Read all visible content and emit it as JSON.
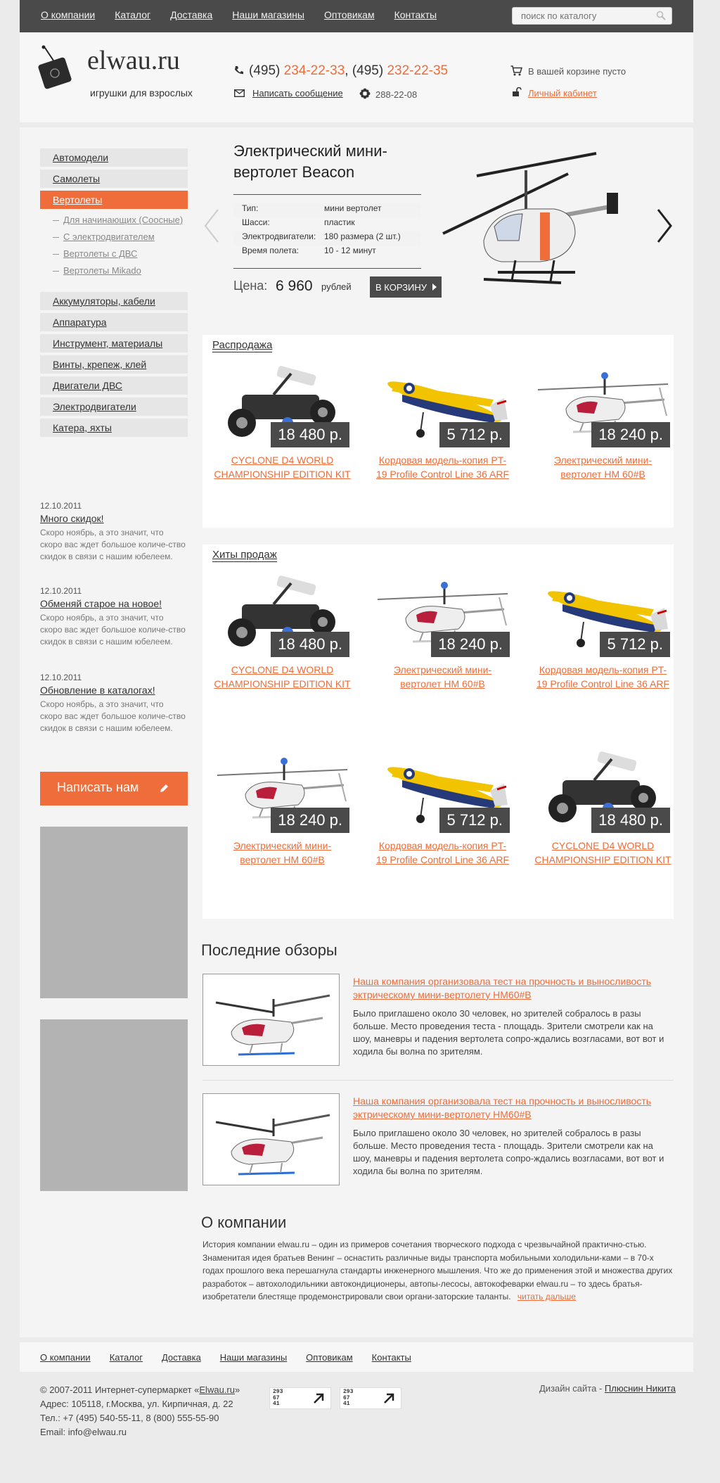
{
  "nav": [
    "О компании",
    "Каталог",
    "Доставка",
    "Наши магазины",
    "Оптовикам",
    "Контакты"
  ],
  "search": {
    "placeholder": "поиск по каталогу",
    "icon": "search-icon"
  },
  "logo": {
    "name": "elwau.ru",
    "tagline": "игрушки для взрослых"
  },
  "contacts": {
    "phone1_code": "(495)",
    "phone1": "234-22-33",
    "sep": ",",
    "phone2_code": "(495)",
    "phone2": "232-22-35",
    "write": "Написать сообщение",
    "icq": "288-22-08"
  },
  "cart": {
    "text": "В вашей корзине пусто",
    "cabinet": "Личный кабинет"
  },
  "sidebar": {
    "top": [
      "Автомодели",
      "Самолеты",
      "Вертолеты"
    ],
    "sub": [
      "Для начинающих (Соосные)",
      "С электродвигателем",
      "Вертолеты с ДВС",
      "Вертолеты Mikado"
    ],
    "rest": [
      "Аккумуляторы, кабели",
      "Аппаратура",
      "Инструмент, материалы",
      "Винты, крепеж, клей",
      "Двигатели ДВС",
      "Электродвигатели",
      "Катера, яхты"
    ]
  },
  "news": [
    {
      "date": "12.10.2011",
      "title": "Много скидок!",
      "text": "Скоро ноябрь, а это значит, что скоро вас ждет большое количе-ство скидок в связи с нашим юбелеем."
    },
    {
      "date": "12.10.2011",
      "title": "Обменяй старое на новое!",
      "text": "Скоро ноябрь, а это значит, что скоро вас ждет большое количе-ство скидок в связи с нашим юбелеем."
    },
    {
      "date": "12.10.2011",
      "title": "Обновление в каталогах!",
      "text": "Скоро ноябрь, а это значит, что скоро вас ждет большое количе-ство скидок в связи с нашим юбелеем."
    }
  ],
  "write_us": "Написать нам",
  "hero": {
    "title": "Электрический мини-вертолет Beacon",
    "specs": [
      [
        "Тип:",
        "мини вертолет"
      ],
      [
        "Шасси:",
        "пластик"
      ],
      [
        "Электродвигатели:",
        "180 размера (2 шт.)"
      ],
      [
        "Время полета:",
        "10 - 12 минут"
      ]
    ],
    "price_label": "Цена:",
    "price": "6 960",
    "currency": "рублей",
    "buy": "В КОРЗИНУ"
  },
  "sale": {
    "title": "Распродажа",
    "items": [
      {
        "name": "CYCLONE D4 WORLD CHAMPIONSHIP EDITION KIT",
        "price": "18 480 р.",
        "kind": "buggy"
      },
      {
        "name": "Кордовая модель-копия PT-19 Profile Control Line 36 ARF",
        "price": "5 712 р.",
        "kind": "plane"
      },
      {
        "name": "Электрический мини-вертолет HM 60#B",
        "price": "18 240 р.",
        "kind": "heli"
      }
    ]
  },
  "hits": {
    "title": "Хиты продаж",
    "items": [
      {
        "name": "CYCLONE D4 WORLD CHAMPIONSHIP EDITION KIT",
        "price": "18 480 р.",
        "kind": "buggy"
      },
      {
        "name": "Электрический мини-вертолет HM 60#B",
        "price": "18 240 р.",
        "kind": "heli"
      },
      {
        "name": "Кордовая модель-копия PT-19 Profile Control Line 36 ARF",
        "price": "5 712 р.",
        "kind": "plane"
      },
      {
        "name": "Электрический мини-вертолет HM 60#B",
        "price": "18 240 р.",
        "kind": "heli"
      },
      {
        "name": "Кордовая модель-копия PT-19 Profile Control Line 36 ARF",
        "price": "5 712 р.",
        "kind": "plane"
      },
      {
        "name": "CYCLONE D4 WORLD CHAMPIONSHIP EDITION KIT",
        "price": "18 480 р.",
        "kind": "buggy"
      }
    ]
  },
  "reviews": {
    "title": "Последние обзоры",
    "items": [
      {
        "title": "Наша компания организовала тест на прочность и выносливость эктрическому мини-вертолету HM60#B",
        "text": "Было приглашено около 30 человек, но зрителей собралось в разы больше. Место проведения теста - площадь. Зрители смотрели как на шоу, маневры и падения вертолета сопро-ждались возгласами, вот вот и ходила бы волна по зрителям."
      },
      {
        "title": "Наша компания организовала тест на прочность и выносливость эктрическому мини-вертолету HM60#B",
        "text": "Было приглашено около 30 человек, но зрителей собралось в разы больше. Место проведения теста - площадь. Зрители смотрели как на шоу, маневры и падения вертолета сопро-ждались возгласами, вот вот и ходила бы волна по зрителям."
      }
    ]
  },
  "about": {
    "title": "О компании",
    "text": "История компании elwau.ru – один из примеров сочетания творческого подхода с чрезвычайной практично-стью. Знаменитая идея братьев Венинг – оснастить различные виды транспорта мобильными холодильни-ками – в 70-х годах прошлого века перешагнула стандарты инженерного мышления. Что же до применения этой и множества других разработок – автохолодильники автокондиционеры, автопы-лесосы, автокофеварки elwau.ru – то здесь братья-изобретатели блестяще продемонстрировали свои органи-заторские таланты.",
    "more": "читать дальше"
  },
  "footer": {
    "copyright_pre": "© 2007-2011 Интернет-супермаркет «",
    "copyright_link": "Elwau.ru",
    "copyright_post": "»",
    "address": "Адрес: 105118, г.Москва, ул. Кирпичная, д. 22",
    "phone": "Тел.: +7 (495) 540-55-11, 8 (800) 555-55-90",
    "email": "Email: info@elwau.ru",
    "counters": [
      [
        "293",
        "67",
        "41"
      ],
      [
        "293",
        "67",
        "41"
      ]
    ],
    "design_label": "Дизайн сайта - ",
    "designer": "Плюснин Никита"
  },
  "colors": {
    "accent": "#ee6d3a",
    "dark": "#4a4a4a"
  }
}
